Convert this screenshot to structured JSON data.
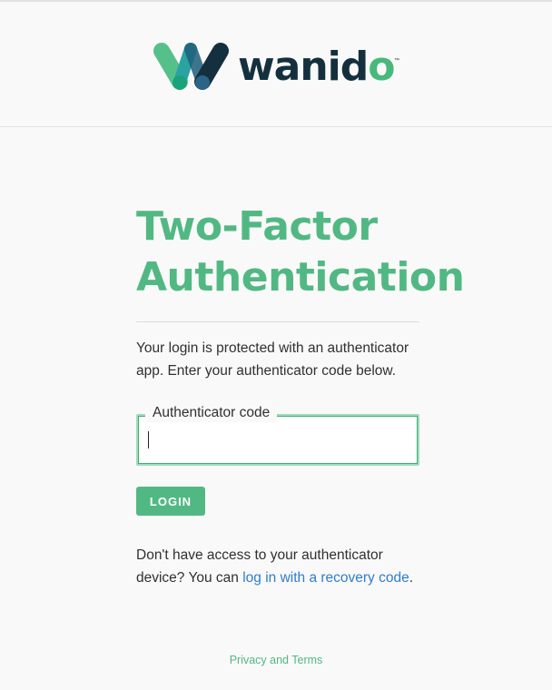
{
  "brand": {
    "name_main": "wanid",
    "name_accent": "o",
    "trademark": "™",
    "colors": {
      "green": "#52b883",
      "navy": "#14303f",
      "teal": "#2aa3a3",
      "link": "#2f7ccf"
    }
  },
  "page": {
    "title": "Two-Factor Authentication",
    "description": "Your login is protected with an authenticator app. Enter your authenticator code below."
  },
  "form": {
    "code_label": "Authenticator code",
    "code_value": "",
    "login_button": "LOGIN"
  },
  "recovery": {
    "prefix": "Don't have access to your authenticator device? You can ",
    "link_text": "log in with a recovery code",
    "suffix": "."
  },
  "footer": {
    "link_text": "Privacy and Terms"
  }
}
